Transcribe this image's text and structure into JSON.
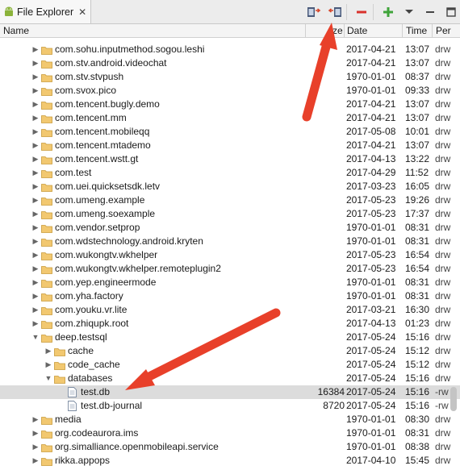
{
  "tab": {
    "title": "File Explorer",
    "close": "✕"
  },
  "toolbar": {
    "buttons": [
      "pull-file-icon",
      "push-file-icon",
      "delete-icon",
      "new-folder-icon",
      "view-menu-icon",
      "maximize-icon"
    ]
  },
  "columns": {
    "name": "Name",
    "size": "ze",
    "date": "Date",
    "time": "Time",
    "permissions": "Per"
  },
  "rows": [
    {
      "name": "com.sohu.inputmethod.sogou.leshi",
      "size": "",
      "date": "2017-04-21",
      "time": "13:07",
      "perm": "drw",
      "type": "folder",
      "expanded": false,
      "depth": 0
    },
    {
      "name": "com.stv.android.videochat",
      "size": "",
      "date": "2017-04-21",
      "time": "13:07",
      "perm": "drw",
      "type": "folder",
      "expanded": false,
      "depth": 0
    },
    {
      "name": "com.stv.stvpush",
      "size": "",
      "date": "1970-01-01",
      "time": "08:37",
      "perm": "drw",
      "type": "folder",
      "expanded": false,
      "depth": 0
    },
    {
      "name": "com.svox.pico",
      "size": "",
      "date": "1970-01-01",
      "time": "09:33",
      "perm": "drw",
      "type": "folder",
      "expanded": false,
      "depth": 0
    },
    {
      "name": "com.tencent.bugly.demo",
      "size": "",
      "date": "2017-04-21",
      "time": "13:07",
      "perm": "drw",
      "type": "folder",
      "expanded": false,
      "depth": 0
    },
    {
      "name": "com.tencent.mm",
      "size": "",
      "date": "2017-04-21",
      "time": "13:07",
      "perm": "drw",
      "type": "folder",
      "expanded": false,
      "depth": 0
    },
    {
      "name": "com.tencent.mobileqq",
      "size": "",
      "date": "2017-05-08",
      "time": "10:01",
      "perm": "drw",
      "type": "folder",
      "expanded": false,
      "depth": 0
    },
    {
      "name": "com.tencent.mtademo",
      "size": "",
      "date": "2017-04-21",
      "time": "13:07",
      "perm": "drw",
      "type": "folder",
      "expanded": false,
      "depth": 0
    },
    {
      "name": "com.tencent.wstt.gt",
      "size": "",
      "date": "2017-04-13",
      "time": "13:22",
      "perm": "drw",
      "type": "folder",
      "expanded": false,
      "depth": 0
    },
    {
      "name": "com.test",
      "size": "",
      "date": "2017-04-29",
      "time": "11:52",
      "perm": "drw",
      "type": "folder",
      "expanded": false,
      "depth": 0
    },
    {
      "name": "com.uei.quicksetsdk.letv",
      "size": "",
      "date": "2017-03-23",
      "time": "16:05",
      "perm": "drw",
      "type": "folder",
      "expanded": false,
      "depth": 0
    },
    {
      "name": "com.umeng.example",
      "size": "",
      "date": "2017-05-23",
      "time": "19:26",
      "perm": "drw",
      "type": "folder",
      "expanded": false,
      "depth": 0
    },
    {
      "name": "com.umeng.soexample",
      "size": "",
      "date": "2017-05-23",
      "time": "17:37",
      "perm": "drw",
      "type": "folder",
      "expanded": false,
      "depth": 0
    },
    {
      "name": "com.vendor.setprop",
      "size": "",
      "date": "1970-01-01",
      "time": "08:31",
      "perm": "drw",
      "type": "folder",
      "expanded": false,
      "depth": 0
    },
    {
      "name": "com.wdstechnology.android.kryten",
      "size": "",
      "date": "1970-01-01",
      "time": "08:31",
      "perm": "drw",
      "type": "folder",
      "expanded": false,
      "depth": 0
    },
    {
      "name": "com.wukongtv.wkhelper",
      "size": "",
      "date": "2017-05-23",
      "time": "16:54",
      "perm": "drw",
      "type": "folder",
      "expanded": false,
      "depth": 0
    },
    {
      "name": "com.wukongtv.wkhelper.remoteplugin2",
      "size": "",
      "date": "2017-05-23",
      "time": "16:54",
      "perm": "drw",
      "type": "folder",
      "expanded": false,
      "depth": 0
    },
    {
      "name": "com.yep.engineermode",
      "size": "",
      "date": "1970-01-01",
      "time": "08:31",
      "perm": "drw",
      "type": "folder",
      "expanded": false,
      "depth": 0
    },
    {
      "name": "com.yha.factory",
      "size": "",
      "date": "1970-01-01",
      "time": "08:31",
      "perm": "drw",
      "type": "folder",
      "expanded": false,
      "depth": 0
    },
    {
      "name": "com.youku.vr.lite",
      "size": "",
      "date": "2017-03-21",
      "time": "16:30",
      "perm": "drw",
      "type": "folder",
      "expanded": false,
      "depth": 0
    },
    {
      "name": "com.zhiqupk.root",
      "size": "",
      "date": "2017-04-13",
      "time": "01:23",
      "perm": "drw",
      "type": "folder",
      "expanded": false,
      "depth": 0
    },
    {
      "name": "deep.testsql",
      "size": "",
      "date": "2017-05-24",
      "time": "15:16",
      "perm": "drw",
      "type": "folder",
      "expanded": true,
      "depth": 0
    },
    {
      "name": "cache",
      "size": "",
      "date": "2017-05-24",
      "time": "15:12",
      "perm": "drw",
      "type": "folder",
      "expanded": false,
      "depth": 1
    },
    {
      "name": "code_cache",
      "size": "",
      "date": "2017-05-24",
      "time": "15:12",
      "perm": "drw",
      "type": "folder",
      "expanded": false,
      "depth": 1
    },
    {
      "name": "databases",
      "size": "",
      "date": "2017-05-24",
      "time": "15:16",
      "perm": "drw",
      "type": "folder",
      "expanded": true,
      "depth": 1
    },
    {
      "name": "test.db",
      "size": "16384",
      "date": "2017-05-24",
      "time": "15:16",
      "perm": "-rw",
      "type": "file",
      "expanded": false,
      "depth": 2,
      "selected": true
    },
    {
      "name": "test.db-journal",
      "size": "8720",
      "date": "2017-05-24",
      "time": "15:16",
      "perm": "-rw",
      "type": "file",
      "expanded": false,
      "depth": 2
    },
    {
      "name": "media",
      "size": "",
      "date": "1970-01-01",
      "time": "08:30",
      "perm": "drw",
      "type": "folder",
      "expanded": false,
      "depth": 0
    },
    {
      "name": "org.codeaurora.ims",
      "size": "",
      "date": "1970-01-01",
      "time": "08:31",
      "perm": "drw",
      "type": "folder",
      "expanded": false,
      "depth": 0
    },
    {
      "name": "org.simalliance.openmobileapi.service",
      "size": "",
      "date": "1970-01-01",
      "time": "08:38",
      "perm": "drw",
      "type": "folder",
      "expanded": false,
      "depth": 0
    },
    {
      "name": "rikka.appops",
      "size": "",
      "date": "2017-04-10",
      "time": "15:45",
      "perm": "drw",
      "type": "folder",
      "expanded": false,
      "depth": 0
    }
  ],
  "colors": {
    "arrow": "#e8402a",
    "folder": "#e8b64c",
    "selected": "#dcdcdc"
  }
}
